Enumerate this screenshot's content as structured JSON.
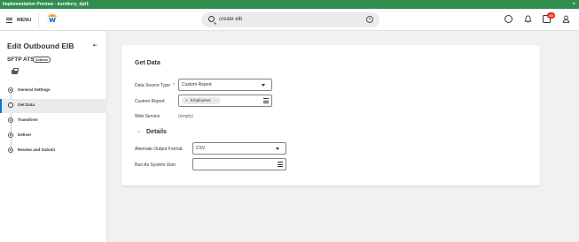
{
  "banner": {
    "title": "Implementation Preview - kornferry_dpt1",
    "close": "×"
  },
  "header": {
    "menu_label": "MENU",
    "search_value": "create eib",
    "inbox_badge": "40",
    "icons": [
      "menu-icon",
      "workday-logo",
      "search-icon",
      "clear-icon",
      "chat-icon",
      "bell-icon",
      "inbox-icon",
      "user-icon"
    ]
  },
  "sidebar": {
    "title": "Edit Outbound EIB",
    "subtitle": "SFTP ATS",
    "actions_label": "Actions",
    "steps": [
      {
        "label": "General Settings",
        "state": "done"
      },
      {
        "label": "Get Data",
        "state": "current"
      },
      {
        "label": "Transform",
        "state": "done"
      },
      {
        "label": "Deliver",
        "state": "done"
      },
      {
        "label": "Review and Submit",
        "state": "done"
      }
    ]
  },
  "main": {
    "title": "Get Data",
    "fields": {
      "data_source_type_label": "Data Source Type",
      "data_source_type_required": "*",
      "data_source_type_value": "Custom Report",
      "custom_report_label": "Custom Report",
      "custom_report_pill": "Employees",
      "custom_report_pill_remove": "×",
      "custom_report_pill_more": "···",
      "web_service_label": "Web Service",
      "web_service_value": "(empty)"
    },
    "details": {
      "toggle": "›",
      "title": "Details",
      "alt_output_format_label": "Alternate Output Format",
      "alt_output_format_value": "CSV",
      "run_as_label": "Run As System User",
      "run_as_value": ""
    }
  },
  "colors": {
    "banner": "#2f8d4e",
    "accent": "#0875e1",
    "badge": "#de2e21",
    "logo": "#f5a31a"
  }
}
